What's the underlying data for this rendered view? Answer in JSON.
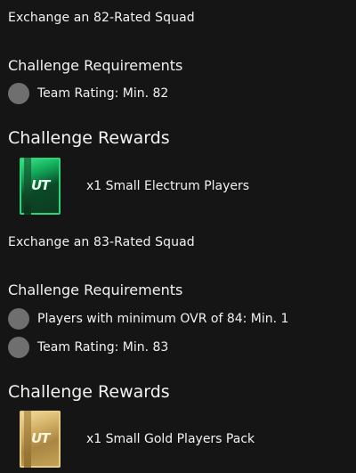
{
  "challenges": [
    {
      "title": "Exchange an 82-Rated Squad",
      "requirements_heading": "Challenge Requirements",
      "requirements": [
        {
          "label": "Team Rating: Min. 82"
        }
      ],
      "rewards_heading": "Challenge Rewards",
      "reward": {
        "label": "x1 Small Electrum Players",
        "pack_icon": "electrum-pack-icon",
        "pack_logo": "UT"
      }
    },
    {
      "title": "Exchange an 83-Rated Squad",
      "requirements_heading": "Challenge Requirements",
      "requirements": [
        {
          "label": "Players with minimum OVR of 84: Min. 1"
        },
        {
          "label": "Team Rating: Min. 83"
        }
      ],
      "rewards_heading": "Challenge Rewards",
      "reward": {
        "label": "x1 Small Gold Players Pack",
        "pack_icon": "gold-pack-icon",
        "pack_logo": "UT"
      }
    }
  ],
  "colors": {
    "background": "#151515",
    "text": "#f2f2f2",
    "status_dot": "#6f6f6f",
    "electrum_accent": "#2bd57a",
    "gold_accent": "#d6b56a"
  }
}
